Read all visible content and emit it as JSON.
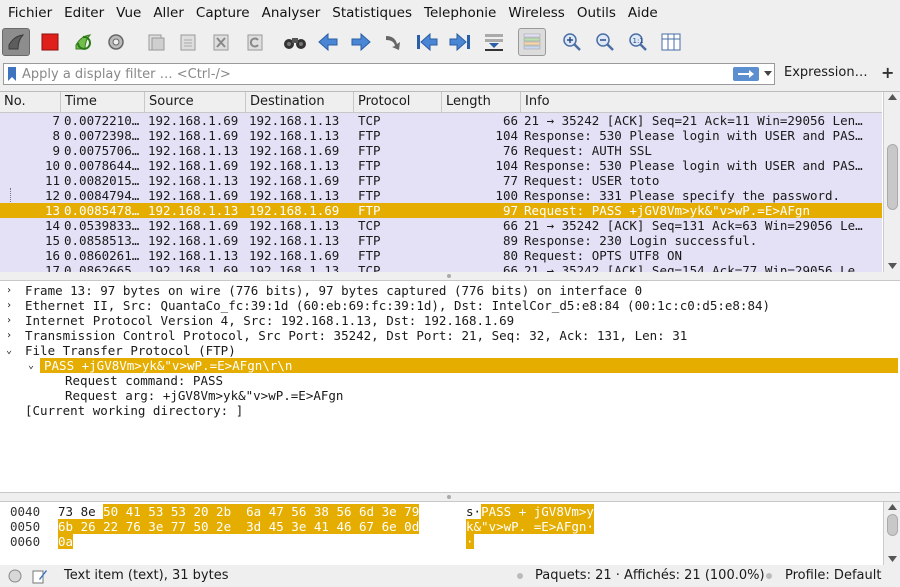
{
  "menu": [
    "Fichier",
    "Editer",
    "Vue",
    "Aller",
    "Capture",
    "Analyser",
    "Statistiques",
    "Telephonie",
    "Wireless",
    "Outils",
    "Aide"
  ],
  "toolbar_icons": [
    "shark-fin-start-icon",
    "stop-capture-icon",
    "restart-capture-icon",
    "capture-options-icon",
    "open-file-icon",
    "save-file-icon",
    "close-file-icon",
    "reload-file-icon",
    "find-packet-icon",
    "go-back-icon",
    "go-forward-icon",
    "go-to-packet-icon",
    "go-first-icon",
    "go-last-icon",
    "autoscroll-icon",
    "colorize-icon",
    "zoom-in-icon",
    "zoom-out-icon",
    "zoom-normal-icon",
    "resize-columns-icon"
  ],
  "filter": {
    "placeholder": "Apply a display filter … <Ctrl-/>",
    "expression_label": "Expression…",
    "add_label": "+"
  },
  "packet_list": {
    "columns": [
      "No.",
      "Time",
      "Source",
      "Destination",
      "Protocol",
      "Length",
      "Info"
    ],
    "rows": [
      {
        "no": "7",
        "time": "0.0072210…",
        "src": "192.168.1.69",
        "dst": "192.168.1.13",
        "proto": "TCP",
        "len": "66",
        "info": "21 → 35242 [ACK] Seq=21 Ack=11 Win=29056 Len…",
        "selected": false
      },
      {
        "no": "8",
        "time": "0.0072398…",
        "src": "192.168.1.69",
        "dst": "192.168.1.13",
        "proto": "FTP",
        "len": "104",
        "info": "Response: 530 Please login with USER and PAS…",
        "selected": false
      },
      {
        "no": "9",
        "time": "0.0075706…",
        "src": "192.168.1.13",
        "dst": "192.168.1.69",
        "proto": "FTP",
        "len": "76",
        "info": "Request: AUTH SSL",
        "selected": false
      },
      {
        "no": "10",
        "time": "0.0078644…",
        "src": "192.168.1.69",
        "dst": "192.168.1.13",
        "proto": "FTP",
        "len": "104",
        "info": "Response: 530 Please login with USER and PAS…",
        "selected": false
      },
      {
        "no": "11",
        "time": "0.0082015…",
        "src": "192.168.1.13",
        "dst": "192.168.1.69",
        "proto": "FTP",
        "len": "77",
        "info": "Request: USER toto",
        "selected": false
      },
      {
        "no": "12",
        "time": "0.0084794…",
        "src": "192.168.1.69",
        "dst": "192.168.1.13",
        "proto": "FTP",
        "len": "100",
        "info": "Response: 331 Please specify the password.",
        "selected": false
      },
      {
        "no": "13",
        "time": "0.0085478…",
        "src": "192.168.1.13",
        "dst": "192.168.1.69",
        "proto": "FTP",
        "len": "97",
        "info": "Request: PASS +jGV8Vm>yk&\"v>wP.=E>AFgn",
        "selected": true
      },
      {
        "no": "14",
        "time": "0.0539833…",
        "src": "192.168.1.69",
        "dst": "192.168.1.13",
        "proto": "TCP",
        "len": "66",
        "info": "21 → 35242 [ACK] Seq=131 Ack=63 Win=29056 Le…",
        "selected": false
      },
      {
        "no": "15",
        "time": "0.0858513…",
        "src": "192.168.1.69",
        "dst": "192.168.1.13",
        "proto": "FTP",
        "len": "89",
        "info": "Response: 230 Login successful.",
        "selected": false
      },
      {
        "no": "16",
        "time": "0.0860261…",
        "src": "192.168.1.13",
        "dst": "192.168.1.69",
        "proto": "FTP",
        "len": "80",
        "info": "Request: OPTS UTF8 ON",
        "selected": false
      },
      {
        "no": "17",
        "time": "0.0862665…",
        "src": "192.168.1.69",
        "dst": "192.168.1.13",
        "proto": "TCP",
        "len": "66",
        "info": "21 → 35242 [ACK] Seq=154 Ack=77 Win=29056 Le…",
        "selected": false
      }
    ]
  },
  "details": [
    {
      "arrow": "›",
      "indent": 0,
      "text": "Frame 13: 97 bytes on wire (776 bits), 97 bytes captured (776 bits) on interface 0",
      "selected": false
    },
    {
      "arrow": "›",
      "indent": 0,
      "text": "Ethernet II, Src: QuantaCo_fc:39:1d (60:eb:69:fc:39:1d), Dst: IntelCor_d5:e8:84 (00:1c:c0:d5:e8:84)",
      "selected": false
    },
    {
      "arrow": "›",
      "indent": 0,
      "text": "Internet Protocol Version 4, Src: 192.168.1.13, Dst: 192.168.1.69",
      "selected": false
    },
    {
      "arrow": "›",
      "indent": 0,
      "text": "Transmission Control Protocol, Src Port: 35242, Dst Port: 21, Seq: 32, Ack: 131, Len: 31",
      "selected": false
    },
    {
      "arrow": "⌄",
      "indent": 0,
      "text": "File Transfer Protocol (FTP)",
      "selected": false
    },
    {
      "arrow": "⌄",
      "indent": 1,
      "text": "PASS +jGV8Vm>yk&\"v>wP.=E>AFgn\\r\\n",
      "selected": true
    },
    {
      "arrow": "",
      "indent": 2,
      "text": "Request command: PASS",
      "selected": false
    },
    {
      "arrow": "",
      "indent": 2,
      "text": "Request arg: +jGV8Vm>yk&\"v>wP.=E>AFgn",
      "selected": false
    },
    {
      "arrow": "",
      "indent": 0,
      "text": "[Current working directory: ]",
      "selected": false
    }
  ],
  "bytes": [
    {
      "offset": "0040",
      "hex_plain": "73 8e ",
      "hex_hl": "50 41 53 53 20 2b  6a 47 56 38 56 6d 3e 79",
      "ascii_plain": "s·",
      "ascii_hl": "PASS + jGV8Vm>y"
    },
    {
      "offset": "0050",
      "hex_plain": "",
      "hex_hl": "6b 26 22 76 3e 77 50 2e  3d 45 3e 41 46 67 6e 0d",
      "ascii_plain": "",
      "ascii_hl": "k&\"v>wP. =E>AFgn·"
    },
    {
      "offset": "0060",
      "hex_plain": "",
      "hex_hl": "0a",
      "ascii_plain": "",
      "ascii_hl": "·"
    }
  ],
  "status": {
    "item": "Text item (text), 31 bytes",
    "packets": "Paquets: 21 · Affichés: 21 (100.0%)",
    "profile": "Profile: Default"
  },
  "colors": {
    "selected": "#e5ad00",
    "row_bg": "#e4e1f6",
    "stop_red": "#e0201b",
    "nav_blue": "#4a86d4"
  }
}
